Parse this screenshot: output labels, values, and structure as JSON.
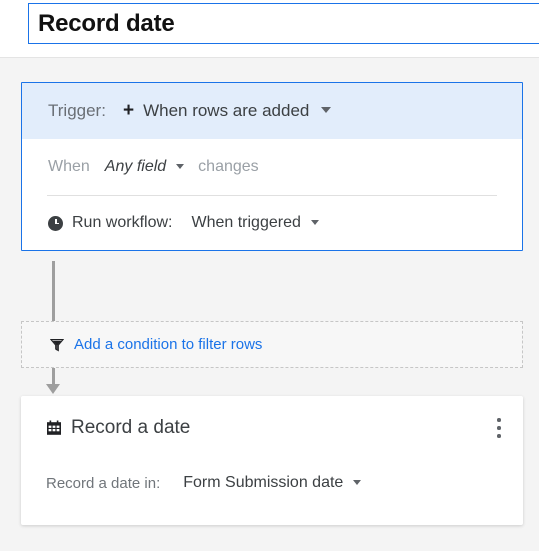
{
  "titlebar": {
    "workflow_name": "Record date"
  },
  "trigger": {
    "label": "Trigger:",
    "plus_icon": "plus-icon",
    "value": "When rows are added",
    "caret_icon": "chevron-down-icon",
    "when_row": {
      "prefix": "When",
      "field": "Any field",
      "field_caret_icon": "chevron-down-icon",
      "suffix": "changes"
    },
    "run_row": {
      "clock_icon": "clock-icon",
      "label": "Run workflow:",
      "value": "When triggered",
      "caret_icon": "chevron-down-icon"
    }
  },
  "condition": {
    "filter_icon": "funnel-icon",
    "link_label": "Add a condition to filter rows"
  },
  "action": {
    "card_icon": "calendar-icon",
    "title": "Record a date",
    "menu_icon": "kebab-menu-icon",
    "field_label": "Record a date in:",
    "field_value": "Form Submission date",
    "field_caret_icon": "chevron-down-icon"
  },
  "colors": {
    "accent_blue": "#1a73e8",
    "trigger_header_bg": "#e2edfb",
    "page_bg": "#f4f4f4",
    "connector_gray": "#9e9e9e",
    "muted_text": "#9aa0a6"
  }
}
